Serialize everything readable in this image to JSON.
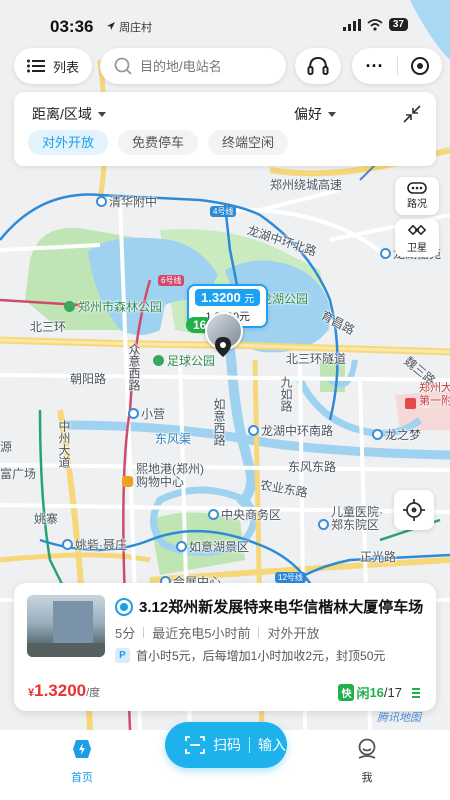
{
  "status": {
    "time": "03:36",
    "location": "周庄村",
    "battery": "37"
  },
  "top": {
    "list_label": "列表",
    "search_placeholder": "目的地/电站名"
  },
  "filters": {
    "distance_label": "距离/区域",
    "preference_label": "偏好",
    "chips": [
      "对外开放",
      "免费停车",
      "终端空闲"
    ]
  },
  "map_tools": {
    "road_label": "路况",
    "satellite_label": "卫星"
  },
  "marker": {
    "price": "1.3200",
    "price_unit": "元",
    "price_secondary": "1.3200元",
    "idle": "16"
  },
  "map_labels": {
    "north_ring_expwy": "郑州绕城高速",
    "tsinghua": "清华附中",
    "line4": "4号线",
    "line6": "6号线",
    "longhu_middle_ring_north": "龙湖中环北路",
    "longhu_park": "龙湖公园",
    "longyuan": "龙湖嘉苑",
    "forest_park": "郑州市森林公园",
    "north3ring": "北三环",
    "north3ring_tunnel": "北三环隧道",
    "football_park": "足球公园",
    "zhongyuan_rd": "众意西路",
    "chaoyang_rd": "朝阳路",
    "xiaoying": "小营",
    "ruyi_west": "如意西路",
    "jiuru": "九如路",
    "longhu_middle_ring_south": "龙湖中环南路",
    "dongfengqu": "东风渠",
    "dongfeng_rd": "东风东路",
    "zhongzhou_ave": "中州大道",
    "mall": "熙地港(郑州)购物中心",
    "nongye_rd": "农业东路",
    "cbd": "中央商务区",
    "childrens_hospital": "儿童医院·郑东院区",
    "ruyihu": "如意湖景区",
    "yaozhai": "姚寨",
    "yaoqiao": "姚砦·聂庄",
    "exhibition": "会展中心",
    "line12": "12号线",
    "zhengguang": "正光路",
    "univ_hospital": "郑州大学第一附属医院(郑东院区)",
    "longzhimeng": "龙之梦",
    "yuchang": "育昌路",
    "weisan": "魏三路",
    "fuguangchang": "富广场",
    "zhongyuan_ave": "中州大道",
    "jinyuan": "金源",
    "yuan": "源"
  },
  "card": {
    "title": "3.12郑州新发展特来电华信楷林大厦停车场",
    "score": "5分",
    "last_charge": "最近充电5小时前",
    "openness": "对外开放",
    "parking_tag": "P",
    "parking_text": "首小时5元，后每增加1小时加收2元，封顶50元",
    "currency": "¥",
    "price": "1.3200",
    "price_unit": "/度",
    "fast_tag": "快",
    "idle_prefix": "闲",
    "idle_count": "16",
    "total": "/17"
  },
  "credit": "腾讯地图",
  "nav": {
    "home": "首页",
    "scan": "扫码",
    "input": "输入",
    "me": "我"
  },
  "colors": {
    "accent": "#1a9ee6",
    "idle_green": "#22b04b",
    "price_red": "#e8332e",
    "lake": "#9fd2f0",
    "park": "#bfe5b4"
  }
}
